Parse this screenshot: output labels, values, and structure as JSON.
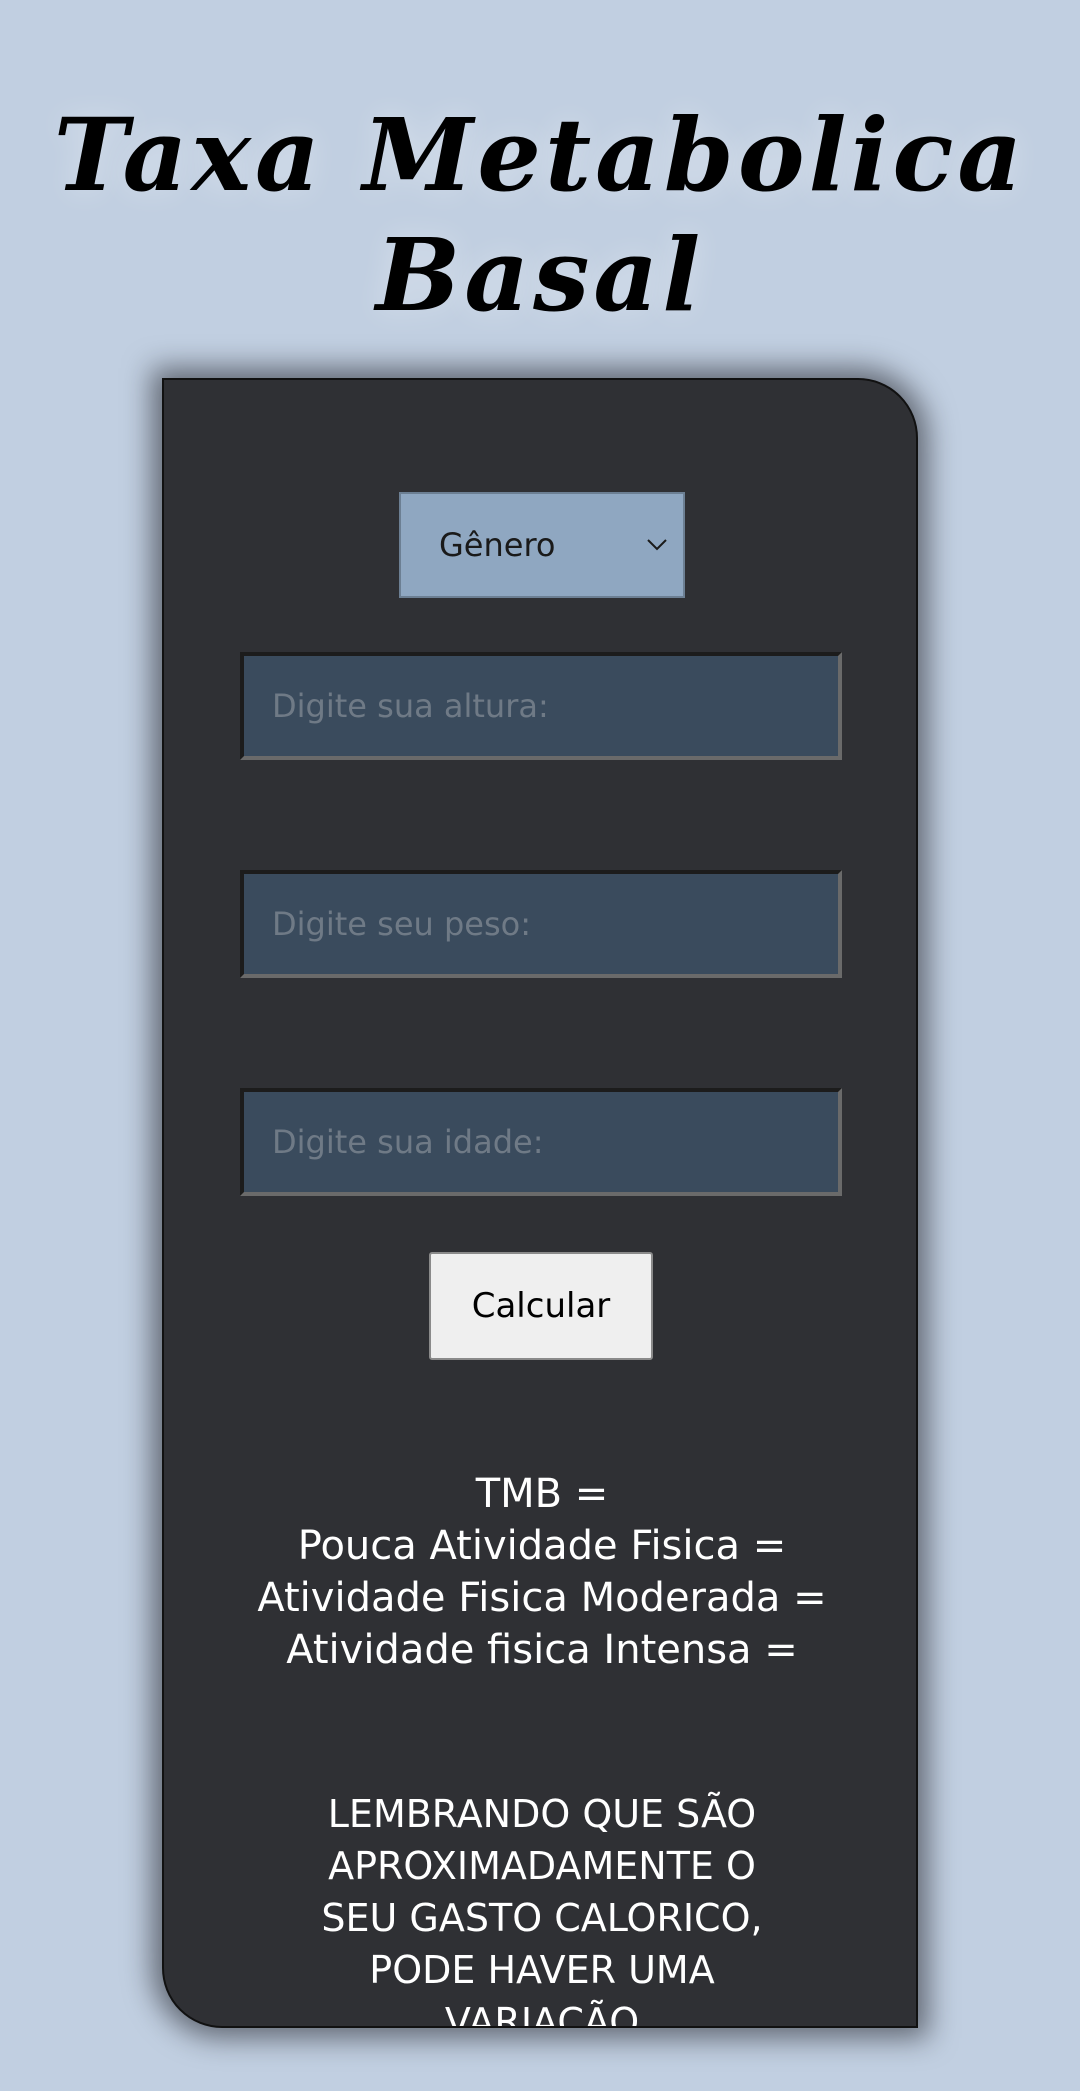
{
  "header": {
    "title_line1": "Taxa Metabolica",
    "title_line2": "Basal"
  },
  "form": {
    "gender_select": {
      "selected": "Gênero"
    },
    "height_input": {
      "placeholder": "Digite sua altura:"
    },
    "weight_input": {
      "placeholder": "Digite seu peso:"
    },
    "age_input": {
      "placeholder": "Digite sua idade:"
    },
    "calculate_label": "Calcular"
  },
  "results": {
    "tmb": "TMB =",
    "low_activity": "Pouca Atividade Fisica =",
    "moderate_activity": "Atividade Fisica Moderada =",
    "intense_activity": "Atividade fisica Intensa ="
  },
  "note": {
    "line1": "LEMBRANDO QUE SÃO",
    "line2": "APROXIMADAMENTE O",
    "line3": "SEU GASTO CALORICO,",
    "line4": "PODE HAVER UMA",
    "line5": "VARIAÇÃO"
  },
  "colors": {
    "background": "#c1cfe1",
    "card": "#2f3034",
    "select": "#8fa7c1",
    "input": "#3a4b5d",
    "button": "#efefef"
  },
  "icons": {
    "select_arrow": "chevron-down-icon"
  }
}
